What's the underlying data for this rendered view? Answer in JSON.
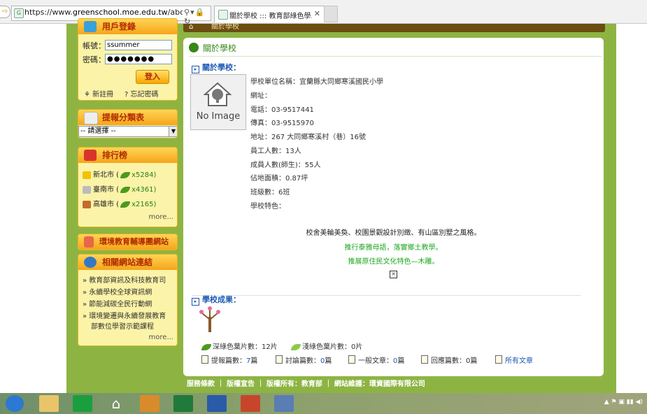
{
  "browser": {
    "url_prefix": "https://www.",
    "url_domain": "greenschool.moe.edu.tw",
    "url_rest": "/about/scl",
    "tab_title": "關於學校 ::: 教育部綠色學..."
  },
  "breadcrumb": "關於學校",
  "login": {
    "title": "用戶登錄",
    "account_label": "帳號：",
    "account_value": "ssummer",
    "password_label": "密碼：",
    "password_value": "●●●●●●●",
    "login_button": "登入",
    "register": "新註冊",
    "forgot": "忘記密碼"
  },
  "report_category": {
    "title": "提報分類表",
    "select_value": "-- 請選擇 --"
  },
  "ranking": {
    "title": "排行榜",
    "items": [
      {
        "city": "新北市 (",
        "count": "x5284)"
      },
      {
        "city": "臺南市 (",
        "count": "x4361)"
      },
      {
        "city": "高雄市 (",
        "count": "x2165)"
      }
    ],
    "more": "more..."
  },
  "guide_link": "環境教育輔導團網站",
  "related": {
    "title": "相關網站連結",
    "items": [
      "» 教育部資訊及科技教育司",
      "» 永續學校全球資訊網",
      "» 節能減碳全民行動網",
      "» 環境變遷與永續發展教育",
      "部數位學習示範課程"
    ],
    "more": "more..."
  },
  "main": {
    "title": "關於學校",
    "about_heading": "關於學校：",
    "no_image": "No Image",
    "info": [
      "學校單位名稱：宜蘭縣大同鄉寒溪國民小學",
      "網址：",
      "電話：03-9517441",
      "傳真：03-9515970",
      "地址：267 大同鄉寒溪村（巷）16號",
      "員工人數：13人",
      "成員人數(師生)：55人",
      "佔地面積：0.87坪",
      "班級數：6班",
      "學校特色："
    ],
    "feature_line1": "校舍美輪美奐、校園景觀設計別緻、有山區別墅之風格。",
    "feature_line2": "推行泰雅母語，落實鄉土教學。",
    "feature_line3": "推展原住民文化特色—木雕。",
    "achievement_heading": "學校成果：",
    "dark_leaf_label": "深綠色葉片數：12片",
    "light_leaf_label": "淺綠色葉片數：0片",
    "posts_label": "提報篇數：",
    "posts_value": "7",
    "discuss_label": "討論篇數：",
    "discuss_value": "0",
    "general_label": "一般文章：",
    "general_value": "0",
    "reply_label": "回應篇數：",
    "reply_value": "0",
    "unit": "篇",
    "all_articles": "所有文章"
  },
  "footer": "服務條款 ｜ 版權宣告 ｜ 版權所有：教育部 ｜ 網站維護：環資國際有限公司",
  "colors": {
    "green_bg": "#8db443",
    "link_blue": "#1b58b4",
    "feature_green": "#1ea81e"
  }
}
